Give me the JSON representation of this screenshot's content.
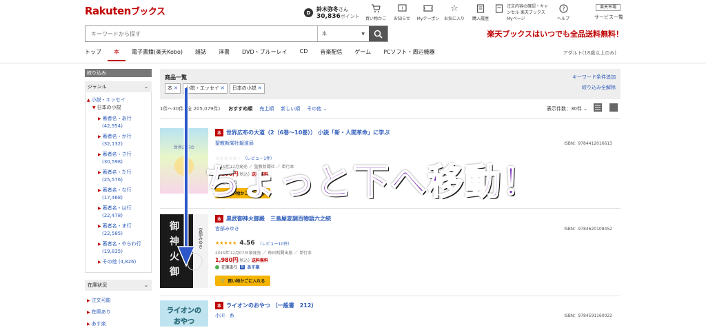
{
  "header": {
    "logo_main": "Rakuten",
    "logo_sub": "ブックス",
    "user_name": "鈴木弥冬",
    "user_suffix": "さん",
    "points": "30,836",
    "points_suffix": "ポイント",
    "nav": [
      {
        "icon": "cart-icon",
        "label": "買い物かご"
      },
      {
        "icon": "bell-icon",
        "label": "お知らせ"
      },
      {
        "icon": "coupon-icon",
        "label": "Myクーポン"
      },
      {
        "icon": "star-icon",
        "label": "お気に入り"
      },
      {
        "icon": "history-icon",
        "label": "購入履歴"
      },
      {
        "icon": "mypage-icon",
        "label": "注文内容の確認・キャンセル 楽天ブックスMyページ"
      },
      {
        "icon": "help-icon",
        "label": "ヘルプ"
      }
    ],
    "rakuten_top": "楽天市場",
    "service_list": "サービス一覧"
  },
  "search": {
    "placeholder": "キーワードから探す",
    "category": "本",
    "promo": "楽天ブックスはいつでも全品送料無料！"
  },
  "catnav": [
    "トップ",
    "本",
    "電子書籍(楽天Kobo)",
    "雑誌",
    "洋書",
    "DVD・ブルーレイ",
    "CD",
    "音楽配信",
    "ゲーム",
    "PCソフト・周辺機器"
  ],
  "adult": "アダルト(18歳以上のみ)",
  "sidebar": {
    "head": "絞り込み",
    "genre_title": "ジャンル",
    "l1": "小説・エッセイ",
    "l2": "日本の小説",
    "items": [
      {
        "label": "著者名・あ行",
        "count": "(42,954)"
      },
      {
        "label": "著者名・か行",
        "count": "(32,132)"
      },
      {
        "label": "著者名・さ行",
        "count": "(30,598)"
      },
      {
        "label": "著者名・た行",
        "count": "(25,576)"
      },
      {
        "label": "著者名・な行",
        "count": "(17,468)"
      },
      {
        "label": "著者名・は行",
        "count": "(22,478)"
      },
      {
        "label": "著者名・ま行",
        "count": "(22,585)"
      },
      {
        "label": "著者名・やらわ行",
        "count": "(19,835)"
      }
    ],
    "other": "その他 (4,826)",
    "stock_title": "在庫状況",
    "stock": [
      "注文可能",
      "在庫あり",
      "あす楽"
    ]
  },
  "filter": {
    "title": "商品一覧",
    "chips": [
      "本",
      "小説・エッセイ",
      "日本の小説"
    ],
    "add_condition": "キーワード条件追加",
    "clear_all": "絞り込み全解除"
  },
  "sort": {
    "count": "1件〜30件 (全 205,079件)",
    "options": [
      "おすすめ順",
      "売上順",
      "新しい順",
      "その他"
    ],
    "perpage": "表示件数：30件"
  },
  "items": [
    {
      "title": "世界広布の大道（2（6巻〜10巻）） 小説「新・人間革命」に学ぶ",
      "author": "聖教新聞社報道局",
      "isbn": "ISBN：9784412016613",
      "stars": "☆☆☆☆☆ -",
      "review": "（レビュー1件）",
      "meta": "2019年12月発売 ／ 聖教新聞社 ／ 単行本",
      "price": "1,100円",
      "price_tax": "(税込)",
      "free": "送料無料",
      "avail": "在庫あり",
      "cart": "買い物かごに入れる"
    },
    {
      "title": "黒武御神火御殿　三島屋変調百物語六之続",
      "author": "宮部みゆき",
      "isbn": "ISBN：9784620108452",
      "stars": "★★★★★",
      "score": "4.56",
      "review": "（レビュー10件）",
      "meta": "2019年12月07日頃発売 ／ 毎日新聞出版 ／ 単行本",
      "price": "1,980円",
      "price_tax": "(税込)",
      "free": "送料無料",
      "avail": "在庫あり",
      "asu": "あす楽",
      "cart": "買い物かごに入れる"
    },
    {
      "title": "ライオンのおやつ （一般書　212）",
      "author": "小川　糸",
      "isbn": "ISBN：9784591160022"
    }
  ],
  "overlay": "ちょっと下へ移動！"
}
